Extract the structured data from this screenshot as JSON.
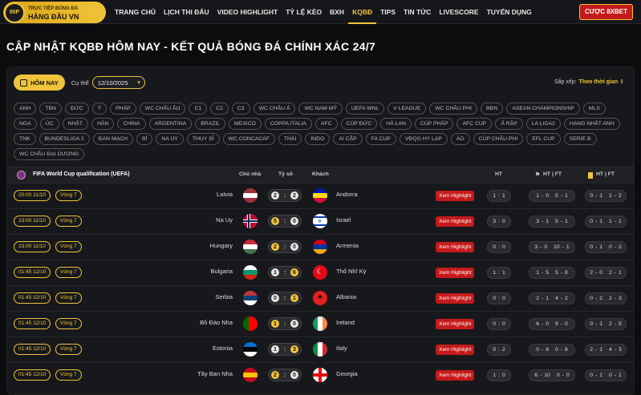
{
  "nav": {
    "logo_line1": "TRỰC TIẾP BÓNG ĐÁ",
    "logo_line2": "HÀNG ĐẦU VN",
    "logo_ball": "90P",
    "items": [
      "TRANG CHỦ",
      "LỊCH THI ĐẤU",
      "VIDEO HIGHLIGHT",
      "TỶ LỆ KÈO",
      "BXH",
      "KQBĐ",
      "TIPS",
      "TIN TỨC",
      "LIVESCORE",
      "TUYỂN DỤNG"
    ],
    "active_index": 5,
    "bet_button": "CƯỢC 8XBET"
  },
  "page_title": "CẬP NHẬT KQBĐ HÔM NAY - KẾT QUẢ BÓNG ĐÁ CHÍNH XÁC 24/7",
  "filter": {
    "today_label": "HÔM NAY",
    "specific_label": "Cụ thể",
    "date_value": "12/10/2025",
    "sort_label": "Sắp xếp:",
    "sort_value": "Theo thời gian"
  },
  "leagues": [
    "ANH",
    "TBN",
    "ĐỨC",
    "Ý",
    "PHÁP",
    "WC CHÂU ÂU",
    "C1",
    "C2",
    "C3",
    "WC CHÂU Á",
    "WC NAM MỸ",
    "UEFA WNL",
    "V LEAGUE",
    "WC CHÂU PHI",
    "BĐN",
    "ASEAN CHAMPIONSHIP",
    "MLS",
    "NGA",
    "ÚC",
    "NHẬT",
    "HÀN",
    "CHINA",
    "ARGENTINA",
    "BRAZIL",
    "MEXICO",
    "COPPA ITALIA",
    "AFC",
    "CÚP ĐỨC",
    "HÀ LAN",
    "CÚP PHÁP",
    "AFC CUP",
    "Ả RẬP",
    "LA LIGA2",
    "HẠNG NHẤT ANH",
    "TNK",
    "BUNDESLIGA 2",
    "ĐAN MẠCH",
    "BỈ",
    "NA UY",
    "THỤY SĨ",
    "WC CONCACAF",
    "THÁI",
    "INDO",
    "AI CẬP",
    "FA CUP",
    "VĐQG HY LẠP",
    "ÁO",
    "CÚP CHÂU PHI",
    "EFL CUP",
    "SERIE B",
    "WC CHÂU ĐẠI DƯƠNG"
  ],
  "table": {
    "league_name": "FIFA World Cup qualification (UEFA)",
    "col_home": "Chủ nhà",
    "col_score": "Tỷ số",
    "col_away": "Khách",
    "col_ht": "HT",
    "col_htft": "HT | FT",
    "col_cards": "HT | FT",
    "highlight_label": "Xem Highlight",
    "matches": [
      {
        "time": "20:00 11/10",
        "round": "Vòng 7",
        "home": "Latvia",
        "hs": "2",
        "as": "2",
        "away": "Andorra",
        "ht": [
          "1",
          "1"
        ],
        "c1": [
          "1",
          "0",
          "5",
          "1"
        ],
        "c2": [
          "0",
          "1",
          "1",
          "2"
        ],
        "hf": [
          "#9e3039",
          "#fff",
          "#9e3039"
        ],
        "af": [
          "#0018a8",
          "#fedf00",
          "#d0103a"
        ],
        "goldh": false,
        "golda": false
      },
      {
        "time": "23:00 11/10",
        "round": "Vòng 7",
        "home": "Na Uy",
        "hs": "5",
        "as": "0",
        "away": "Israel",
        "ht": [
          "3",
          "0"
        ],
        "c1": [
          "3",
          "1",
          "5",
          "1"
        ],
        "c2": [
          "0",
          "1",
          "1",
          "1"
        ],
        "hf": "no",
        "af": "il",
        "goldh": true,
        "golda": false
      },
      {
        "time": "23:00 11/10",
        "round": "Vòng 7",
        "home": "Hungary",
        "hs": "2",
        "as": "0",
        "away": "Armenia",
        "ht": [
          "0",
          "0"
        ],
        "c1": [
          "3",
          "0",
          "10",
          "1"
        ],
        "c2": [
          "0",
          "1",
          "0",
          "2"
        ],
        "hf": [
          "#ce2939",
          "#fff",
          "#477050"
        ],
        "af": [
          "#d90012",
          "#0033a0",
          "#f2a800"
        ],
        "goldh": true,
        "golda": false
      },
      {
        "time": "01:45 12/10",
        "round": "Vòng 7",
        "home": "Bulgaria",
        "hs": "1",
        "as": "6",
        "away": "Thổ Nhĩ Kỳ",
        "ht": [
          "1",
          "1"
        ],
        "c1": [
          "1",
          "5",
          "5",
          "8"
        ],
        "c2": [
          "2",
          "0",
          "2",
          "1"
        ],
        "hf": [
          "#fff",
          "#00966e",
          "#d62612"
        ],
        "af": "tr",
        "goldh": false,
        "golda": true
      },
      {
        "time": "01:45 12/10",
        "round": "Vòng 7",
        "home": "Serbia",
        "hs": "0",
        "as": "1",
        "away": "Albania",
        "ht": [
          "0",
          "0"
        ],
        "c1": [
          "2",
          "1",
          "4",
          "2"
        ],
        "c2": [
          "0",
          "2",
          "2",
          "3"
        ],
        "hf": [
          "#c6363c",
          "#0c4076",
          "#fff"
        ],
        "af": "al",
        "goldh": false,
        "golda": true
      },
      {
        "time": "01:45 12/10",
        "round": "Vòng 7",
        "home": "Bồ Đào Nha",
        "hs": "1",
        "as": "0",
        "away": "Ireland",
        "ht": [
          "0",
          "0"
        ],
        "c1": [
          "6",
          "0",
          "9",
          "0"
        ],
        "c2": [
          "0",
          "1",
          "2",
          "5"
        ],
        "hf": "pt",
        "af": "ie",
        "goldh": true,
        "golda": false
      },
      {
        "time": "01:45 12/10",
        "round": "Vòng 7",
        "home": "Estonia",
        "hs": "1",
        "as": "3",
        "away": "Italy",
        "ht": [
          "0",
          "2"
        ],
        "c1": [
          "0",
          "8",
          "0",
          "8"
        ],
        "c2": [
          "2",
          "1",
          "4",
          "3"
        ],
        "hf": [
          "#0072ce",
          "#000",
          "#fff"
        ],
        "af": "it",
        "goldh": false,
        "golda": true
      },
      {
        "time": "01:45 12/10",
        "round": "Vòng 7",
        "home": "Tây Ban Nha",
        "hs": "2",
        "as": "0",
        "away": "Georgia",
        "ht": [
          "1",
          "0"
        ],
        "c1": [
          "6",
          "10",
          "0",
          "0"
        ],
        "c2": [
          "0",
          "1",
          "0",
          "1"
        ],
        "hf": [
          "#c60b1e",
          "#ffc400",
          "#c60b1e"
        ],
        "af": "ge",
        "goldh": true,
        "golda": false
      }
    ]
  },
  "colors": {
    "accent": "#f0c43a",
    "highlight_red": "#c51a1a",
    "background": "#0b0c0e"
  },
  "icons": {
    "today": "calendar-icon",
    "league": "uefa-icon",
    "sort": "sort-arrows-icon",
    "yellow_card": "yellow-card-icon",
    "corner": "corner-flag-icon"
  }
}
